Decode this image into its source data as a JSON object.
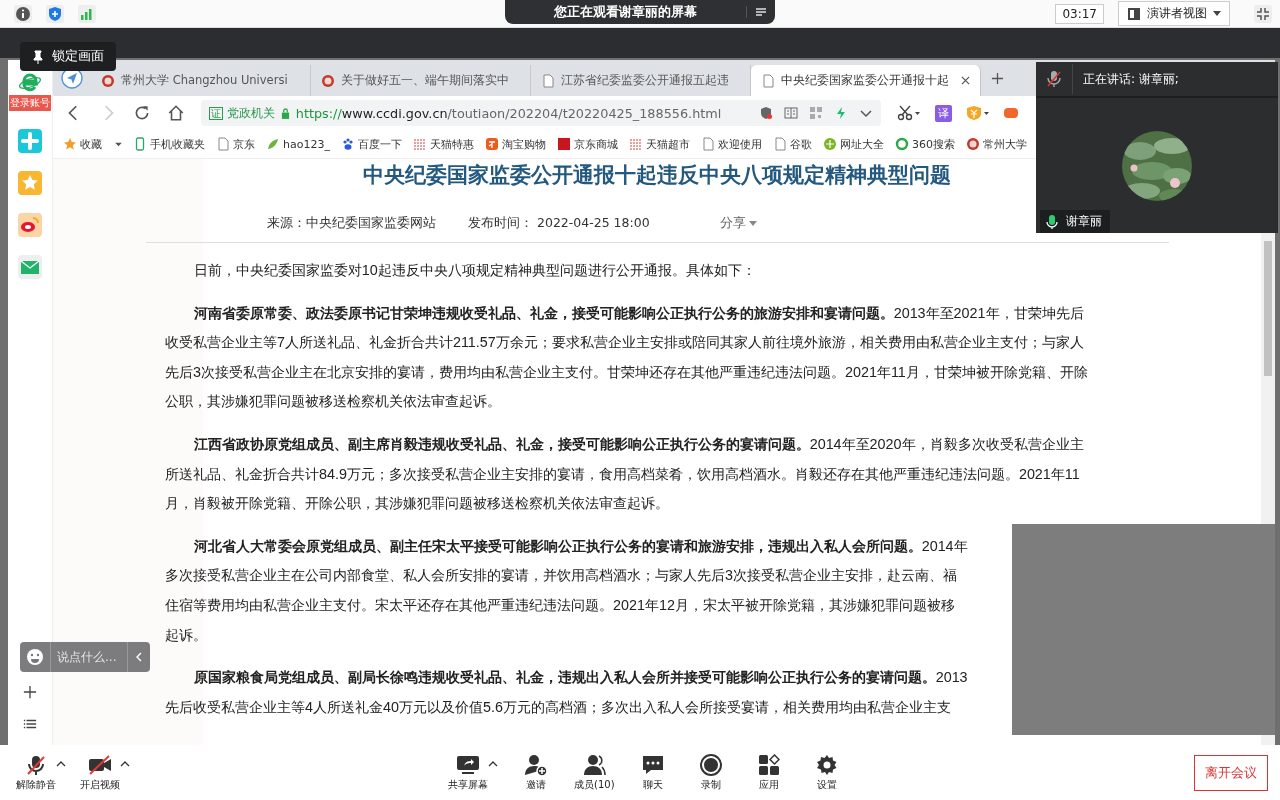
{
  "top_bar": {
    "sharing_banner": "您正在观看谢章丽的屏幕",
    "timer": "03:17",
    "view_mode": "演讲者视图"
  },
  "lock_tooltip": "锁定画面",
  "sidebar": {
    "login_badge": "登录账号"
  },
  "browser": {
    "tabs": [
      {
        "label": "常州大学 Changzhou Universi",
        "kind": "seal",
        "selected": false
      },
      {
        "label": "关于做好五一、端午期间落实中",
        "kind": "seal",
        "selected": false
      },
      {
        "label": "江苏省纪委监委公开通报五起违",
        "kind": "page",
        "selected": false
      },
      {
        "label": "中央纪委国家监委公开通报十起",
        "kind": "page",
        "selected": true
      }
    ],
    "forward_disabled": true,
    "address": {
      "badge": "证",
      "site_type": "党政机关",
      "url_scheme": "https://",
      "url_host": "www.ccdi.gov.cn",
      "url_path": "/toutiaon/202204/t20220425_188556.html"
    },
    "translate_label": "译",
    "bookmarks": [
      {
        "label": "收藏",
        "kind": "star"
      },
      {
        "label": "手机收藏夹",
        "kind": "phone"
      },
      {
        "label": "京东",
        "kind": "page"
      },
      {
        "label": "hao123_",
        "kind": "hao"
      },
      {
        "label": "百度一下",
        "kind": "paw"
      },
      {
        "label": "天猫特惠",
        "kind": "grid"
      },
      {
        "label": "淘宝购物",
        "kind": "tao"
      },
      {
        "label": "京东商城",
        "kind": "jd"
      },
      {
        "label": "天猫超市",
        "kind": "grid"
      },
      {
        "label": "欢迎使用",
        "kind": "page"
      },
      {
        "label": "谷歌",
        "kind": "page"
      },
      {
        "label": "网址大全",
        "kind": "globe"
      },
      {
        "label": "360搜索",
        "kind": "ring"
      },
      {
        "label": "常州大学",
        "kind": "seal"
      }
    ]
  },
  "article": {
    "title": "中央纪委国家监委公开通报十起违反中央八项规定精神典型问题",
    "source": "来源：中央纪委国家监委网站",
    "published": "发布时间： 2022-04-25 18:00",
    "share": "分享",
    "paragraphs": [
      {
        "lines": [
          "日前，中央纪委国家监委对10起违反中央八项规定精神典型问题进行公开通报。具体如下："
        ]
      },
      {
        "lines": [
          "**河南省委原常委、政法委原书记甘荣坤违规收受礼品、礼金，接受可能影响公正执行公务的旅游安排和宴请问题。**2013年至2021年，甘荣坤先后",
          "收受私营企业主等7人所送礼品、礼金折合共计211.57万余元；要求私营企业主安排或陪同其家人前往境外旅游，相关费用由私营企业主支付；与家人",
          "先后3次接受私营企业主在北京安排的宴请，费用均由私营企业主支付。甘荣坤还存在其他严重违纪违法问题。2021年11月，甘荣坤被开除党籍、开除",
          "公职，其涉嫌犯罪问题被移送检察机关依法审查起诉。"
        ]
      },
      {
        "lines": [
          "**江西省政协原党组成员、副主席肖毅违规收受礼品、礼金，接受可能影响公正执行公务的宴请问题。**2014年至2020年，肖毅多次收受私营企业主",
          "所送礼品、礼金折合共计84.9万元；多次接受私营企业主安排的宴请，食用高档菜肴，饮用高档酒水。肖毅还存在其他严重违纪违法问题。2021年11",
          "月，肖毅被开除党籍、开除公职，其涉嫌犯罪问题被移送检察机关依法审查起诉。"
        ]
      },
      {
        "lines": [
          "**河北省人大常委会原党组成员、副主任宋太平接受可能影响公正执行公务的宴请和旅游安排，违规出入私人会所问题。**2014年",
          "多次接受私营企业主在公司内部食堂、私人会所安排的宴请，并饮用高档酒水；与家人先后3次接受私营企业主安排，赴云南、福",
          "住宿等费用均由私营企业主支付。宋太平还存在其他严重违纪违法问题。2021年12月，宋太平被开除党籍，其涉嫌犯罪问题被移",
          "起诉。"
        ]
      },
      {
        "lines": [
          "**原国家粮食局党组成员、副局长徐鸣违规收受礼品、礼金，违规出入私人会所并接受可能影响公正执行公务的宴请问题。**2013",
          "先后收受私营企业主等4人所送礼金40万元以及价值5.6万元的高档酒；多次出入私人会所接受宴请，相关费用均由私营企业主支"
        ]
      }
    ]
  },
  "video_panel": {
    "speaking": "正在讲话: 谢章丽;",
    "participant": "谢章丽"
  },
  "chat_input": {
    "placeholder": "说点什么..."
  },
  "toolbar": {
    "left": [
      {
        "label": "解除静音",
        "kind": "mic-off",
        "menu": true
      },
      {
        "label": "开启视频",
        "kind": "video-off",
        "menu": true
      }
    ],
    "center": [
      {
        "label": "共享屏幕",
        "kind": "share",
        "menu": true
      },
      {
        "label": "邀请",
        "kind": "invite",
        "menu": false
      },
      {
        "label": "成员(10)",
        "kind": "members",
        "menu": false
      },
      {
        "label": "聊天",
        "kind": "chat",
        "menu": false
      },
      {
        "label": "录制",
        "kind": "record",
        "menu": false
      },
      {
        "label": "应用",
        "kind": "apps",
        "menu": false
      },
      {
        "label": "设置",
        "kind": "settings",
        "menu": false
      }
    ],
    "leave": "离开会议"
  }
}
